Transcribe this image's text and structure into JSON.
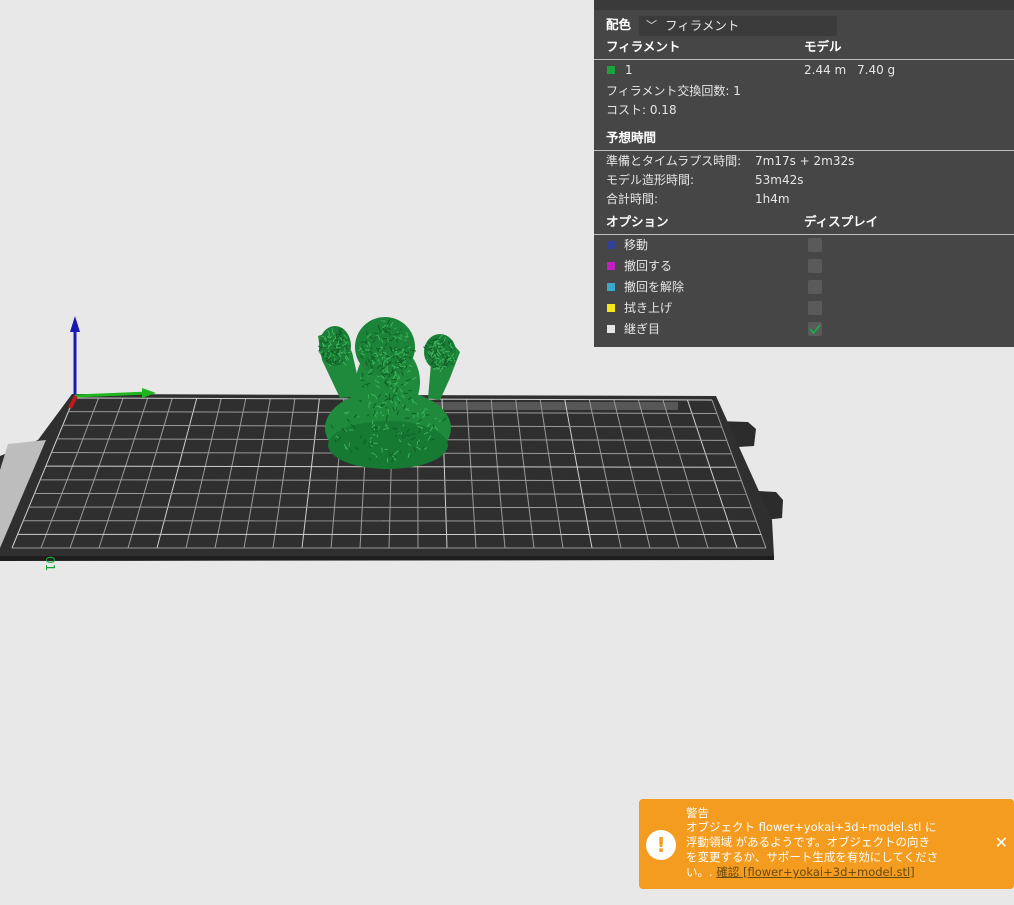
{
  "colors": {
    "canvas_bg": "#e8e8e8",
    "panel_bg": "#464646",
    "model_green": "#1f8a3c",
    "toast_bg": "#f39c1f",
    "axis_x": "#1fb51f",
    "axis_y": "#1a1ab0",
    "axis_z": "#c01a1a"
  },
  "panel": {
    "scheme_label": "配色",
    "scheme_value": "フィラメント",
    "filament_header": "フィラメント",
    "model_header": "モデル",
    "filament": {
      "swatch_color": "#1aa33a",
      "number": "1",
      "length": "2.44 m",
      "weight": "7.40 g"
    },
    "change_count": "フィラメント交換回数:  1",
    "cost": "コスト:  0.18",
    "time_header": "予想時間",
    "prep_label": "準備とタイムラプス時間:",
    "prep_value": "7m17s + 2m32s",
    "model_time_label": "モデル造形時間:",
    "model_time_value": "53m42s",
    "total_label": "合計時間:",
    "total_value": "1h4m",
    "options_header": "オプション",
    "display_header": "ディスプレイ",
    "options": [
      {
        "label": "移動",
        "color": "#2e3f9b",
        "checked": false
      },
      {
        "label": "撤回する",
        "color": "#c21fc2",
        "checked": false
      },
      {
        "label": "撤回を解除",
        "color": "#3aa8c8",
        "checked": false
      },
      {
        "label": "拭き上げ",
        "color": "#f5e81a",
        "checked": false
      },
      {
        "label": "継ぎ目",
        "color": "#e6e6e6",
        "checked": true
      }
    ]
  },
  "toast": {
    "title": "警告",
    "line1": "オブジェクト flower+yokai+3d+model.stl に",
    "line2": "浮動領域 があるようです。オブジェクトの向き",
    "line3": "を変更するか、サポート生成を有効にしてくださ",
    "line4_prefix": "い。.",
    "link": "確認 [flower+yokai+3d+model.stl]",
    "icon": "exclamation-icon",
    "close_icon": "close-icon"
  }
}
